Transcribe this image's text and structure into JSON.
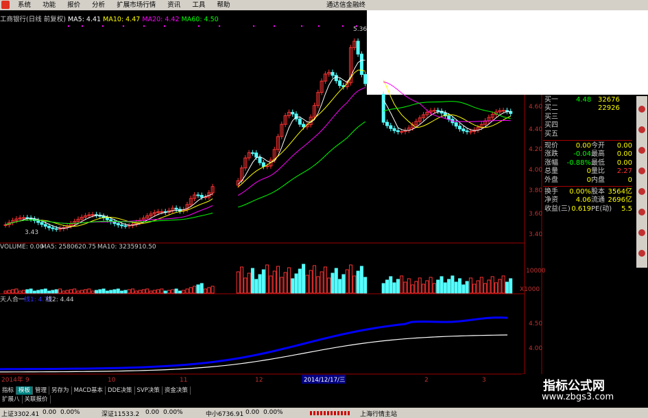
{
  "menu": {
    "items": [
      "系统",
      "功能",
      "报价",
      "分析",
      "扩展市场行情",
      "资讯",
      "工具",
      "帮助"
    ],
    "brand": "通达信金融终"
  },
  "chart_header": {
    "stock": "工商银行(日线 前复权)",
    "ma5": "MA5: 4.41",
    "ma10": "MA10: 4.47",
    "ma20": "MA20: 4.42",
    "ma60": "MA60: 4.50"
  },
  "price_axis": [
    "4.60",
    "4.40",
    "4.20",
    "4.00",
    "3.80",
    "3.60",
    "3.40"
  ],
  "price_marks": {
    "high": "5.36",
    "low": "3.43"
  },
  "volume_header": {
    "volume": "VOLUME: 0.00",
    "ma5": "MA5: 2580620.75",
    "ma10": "MA10: 3235910.50"
  },
  "volume_axis": {
    "top": "10000",
    "unit": "X1000"
  },
  "indicator_header": {
    "name": "天人合一",
    "line1": "线1: 4.72",
    "line2": "线2: 4.44"
  },
  "indicator_axis": [
    "4.50",
    "4.00"
  ],
  "date_axis": {
    "year": "2014年",
    "labels": [
      "9",
      "10",
      "11",
      "12",
      "2",
      "3"
    ],
    "cursor": "2014/12/17/三"
  },
  "quote_panel": {
    "bids": [
      {
        "label": "买一",
        "price": "4.48",
        "vol": "32676"
      },
      {
        "label": "买二",
        "price": "",
        "vol": "22926"
      },
      {
        "label": "买三",
        "price": "",
        "vol": ""
      },
      {
        "label": "买四",
        "price": "",
        "vol": ""
      },
      {
        "label": "买五",
        "price": "",
        "vol": ""
      }
    ],
    "rows": [
      {
        "l1": "现价",
        "v1": "0.00",
        "l2": "今开",
        "v2": "0.00"
      },
      {
        "l1": "涨跌",
        "v1": "-0.04",
        "l2": "最高",
        "v2": "0.00"
      },
      {
        "l1": "涨幅",
        "v1": "-0.88%",
        "l2": "最低",
        "v2": "0.00"
      },
      {
        "l1": "总量",
        "v1": "0",
        "l2": "量比",
        "v2": "2.27"
      },
      {
        "l1": "外盘",
        "v1": "0",
        "l2": "内盘",
        "v2": "0"
      }
    ],
    "rows2": [
      {
        "l1": "换手",
        "v1": "0.00%",
        "l2": "股本",
        "v2": "3564亿"
      },
      {
        "l1": "净资",
        "v1": "4.06",
        "l2": "流通",
        "v2": "2696亿"
      },
      {
        "l1": "收益(三)",
        "v1": "0.619",
        "l2": "PE(动)",
        "v2": "5.5"
      }
    ]
  },
  "tabs1": [
    "指标",
    "模板",
    "管理",
    "另存为",
    "MACD基本",
    "DDE决策",
    "SVP决策",
    "资金决策"
  ],
  "tabs2": [
    "扩展八",
    "关联报价"
  ],
  "status": {
    "sh": "上证3302.41",
    "sh_chg": "0.00",
    "sh_pct": "0.00%",
    "sz": "深证11533.2",
    "sz_chg": "0.00",
    "sz_pct": "0.00%",
    "zx": "中小6736.91",
    "zx_chg": "0.00",
    "zx_pct": "0.00%",
    "server": "上海行情主站"
  },
  "watermark": {
    "title": "指标公式网",
    "url": "www.zbgs3.com"
  },
  "colors": {
    "up": "#ff3333",
    "down": "#55ffff",
    "ma5": "#ffffff",
    "ma10": "#ffff00",
    "ma20": "#ff00ff",
    "ma60": "#00ff00",
    "line1": "#0000ff",
    "line2": "#ffffff"
  }
}
